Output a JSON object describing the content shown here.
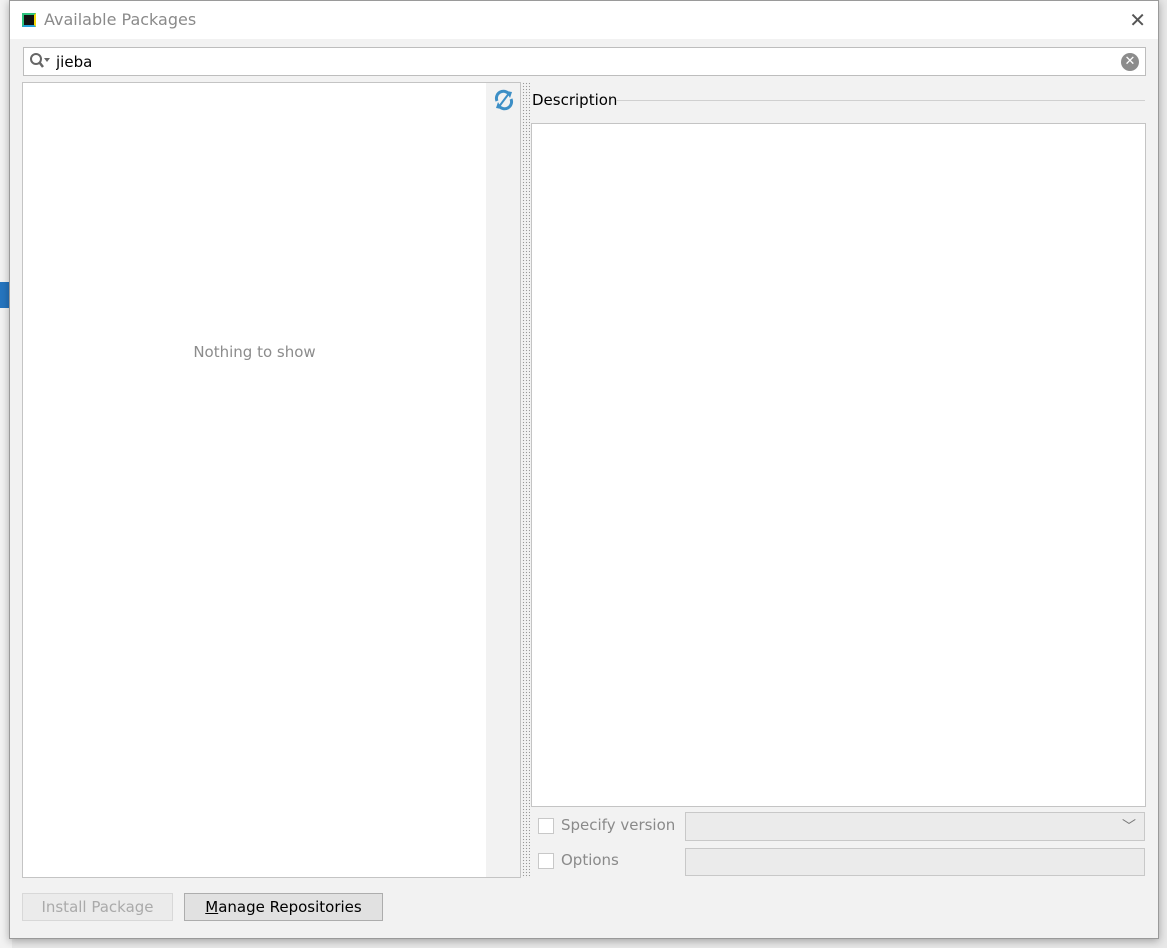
{
  "window": {
    "title": "Available Packages",
    "close_icon": "close-icon"
  },
  "search": {
    "value": "jieba",
    "icon": "search-icon"
  },
  "package_list": {
    "empty_text": "Nothing to show",
    "refresh_icon": "refresh-icon"
  },
  "description": {
    "label": "Description",
    "text": ""
  },
  "specify_version": {
    "label": "Specify version",
    "checked": false,
    "selected": ""
  },
  "options": {
    "label": "Options",
    "checked": false,
    "value": ""
  },
  "buttons": {
    "install_label": "Install Package",
    "manage_first": "M",
    "manage_rest": "anage Repositories"
  },
  "colors": {
    "accent": "#3d8fc6",
    "selection": "#2675bf"
  }
}
